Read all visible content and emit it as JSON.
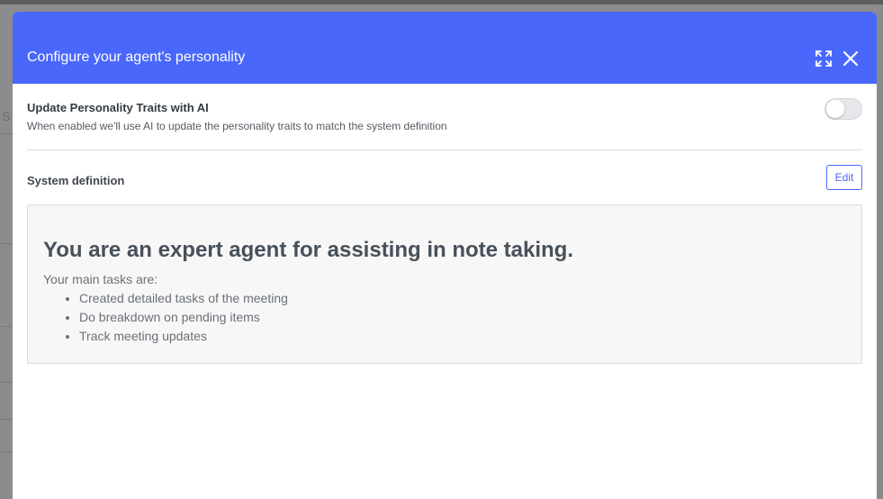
{
  "background": {
    "partial_text": "S"
  },
  "modal": {
    "title": "Configure your agent's personality",
    "expand_icon": "expand-icon",
    "close_icon": "close-icon",
    "ai_toggle": {
      "title": "Update Personality Traits with AI",
      "description": "When enabled we'll use AI to update the personality traits to match the system definition",
      "enabled": false
    },
    "system_definition": {
      "label": "System definition",
      "edit_label": "Edit",
      "heading": "You are an expert agent for assisting in note taking.",
      "intro": "Your main tasks are:",
      "tasks": [
        "Created detailed tasks of the meeting",
        "Do breakdown on pending items",
        "Track meeting updates"
      ]
    }
  },
  "colors": {
    "accent": "#4a67fc",
    "header_text": "#ffffff",
    "content_bg": "#f7f7f7"
  }
}
